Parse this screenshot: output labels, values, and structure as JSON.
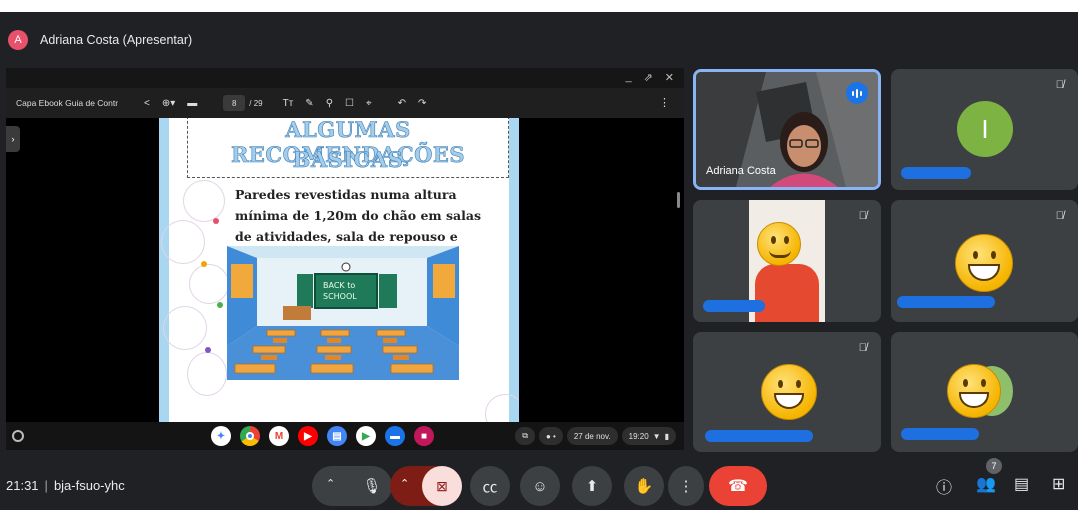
{
  "presenter": {
    "avatar_letter": "A",
    "label": "Adriana Costa (Apresentar)"
  },
  "shared_window": {
    "controls": [
      "_",
      "⇗",
      "✕"
    ],
    "document_title": "Capa Ebook Guia de Contr",
    "current_page": "8",
    "total_pages": "/ 29",
    "slide": {
      "title_line1": "ALGUMAS RECOMENDAÇÕES",
      "title_line2": "BÁSICAS",
      "body": "Paredes revestidas numa altura mínima de 1,20m do chão em salas de atividades, sala de repouso e berçário:",
      "board_text_line1": "BACK to",
      "board_text_line2": "SCHOOL"
    },
    "taskbar": {
      "date": "27 de nov.",
      "time": "19:20"
    }
  },
  "participants": [
    {
      "name": "Adriana Costa",
      "type": "video",
      "speaking": true
    },
    {
      "name": "",
      "type": "letter",
      "letter": "I",
      "muted": true
    },
    {
      "name": "",
      "type": "emoji",
      "muted": true
    },
    {
      "name": "",
      "type": "emoji",
      "muted": true
    },
    {
      "name": "",
      "type": "emoji",
      "muted": true
    },
    {
      "name": "",
      "type": "emoji",
      "muted": false
    }
  ],
  "meeting": {
    "time": "21:31",
    "code": "bja-fsuo-yhc",
    "participant_count": "7"
  },
  "colors": {
    "background": "#202124",
    "tile": "#3c4043",
    "active_border": "#8ab4f8",
    "end_call": "#ea4335",
    "camera_off": "#f9dedc",
    "redaction": "#1e6fe0"
  }
}
